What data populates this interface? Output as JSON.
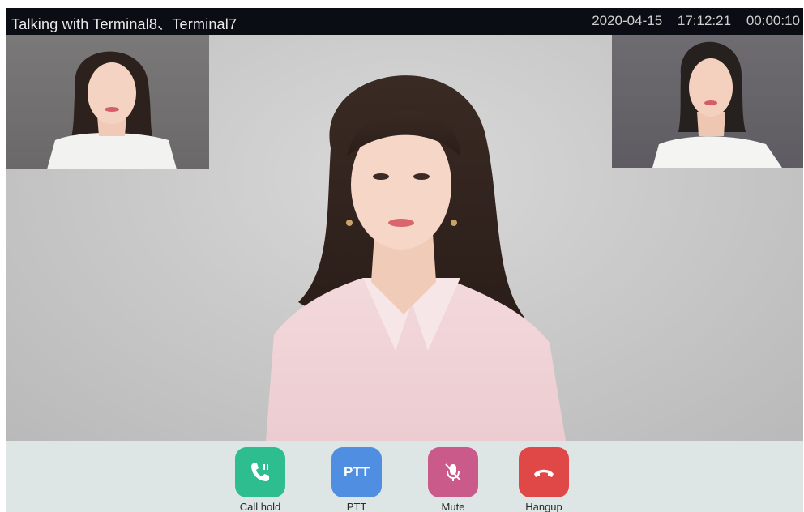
{
  "header": {
    "title": "Talking with Terminal8、Terminal7",
    "date": "2020-04-15",
    "time": "17:12:21",
    "duration": "00:00:10"
  },
  "controls": [
    {
      "label": "Call hold",
      "icon": "call-hold-icon",
      "color": "#2dbd8f"
    },
    {
      "label": "PTT",
      "icon_text": "PTT",
      "color": "#4f8ee0"
    },
    {
      "label": "Mute",
      "icon": "mic-muted-icon",
      "color": "#c95a8a"
    },
    {
      "label": "Hangup",
      "icon": "hangup-icon",
      "color": "#e04848"
    }
  ]
}
